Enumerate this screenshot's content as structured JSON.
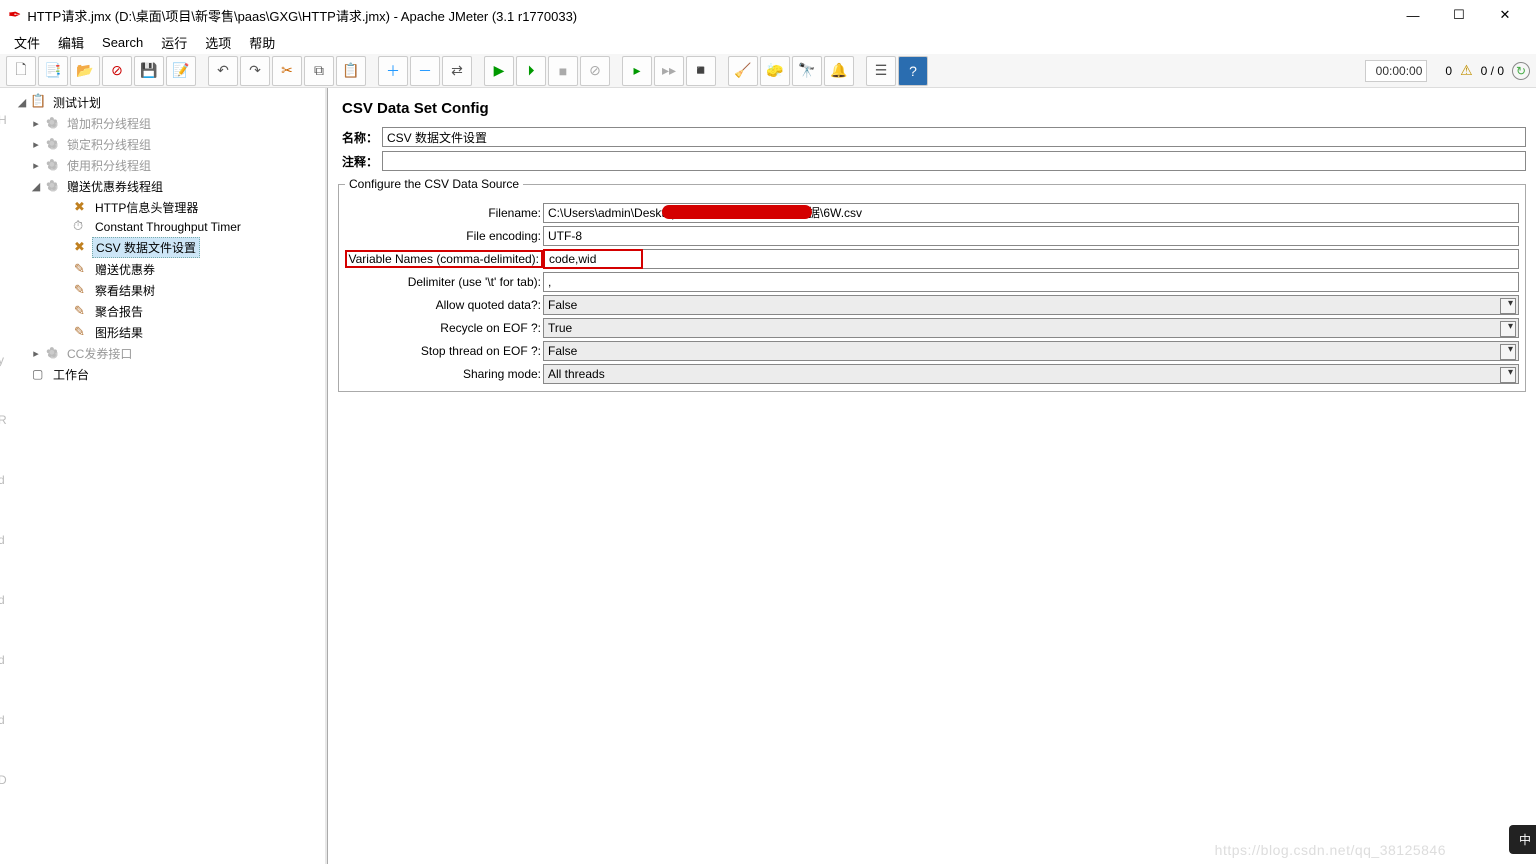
{
  "window": {
    "title": "HTTP请求.jmx (D:\\桌面\\项目\\新零售\\paas\\GXG\\HTTP请求.jmx) - Apache JMeter (3.1 r1770033)",
    "timer": "00:00:00",
    "warn_count": "0",
    "threads": "0 / 0"
  },
  "menu": {
    "file": "文件",
    "edit": "编辑",
    "search": "Search",
    "run": "运行",
    "options": "选项",
    "help": "帮助"
  },
  "tree": {
    "root": "测试计划",
    "g1": "增加积分线程组",
    "g2": "锁定积分线程组",
    "g3": "使用积分线程组",
    "g4": "赠送优惠券线程组",
    "g4c1": "HTTP信息头管理器",
    "g4c2": "Constant Throughput Timer",
    "g4c3": "CSV 数据文件设置",
    "g4c4": "赠送优惠券",
    "g4c5": "察看结果树",
    "g4c6": "聚合报告",
    "g4c7": "图形结果",
    "g5": "CC发券接口",
    "workbench": "工作台"
  },
  "panel": {
    "title": "CSV Data Set Config",
    "name_label": "名称：",
    "name_value": "CSV 数据文件设置",
    "comment_label": "注释：",
    "comment_value": "",
    "legend": "Configure the CSV Data Source",
    "filename_label": "Filename:",
    "filename_value": "C:\\Users\\admin\\Desktop\\                                     压测数据\\优惠券压测数据\\6W.csv",
    "encoding_label": "File encoding:",
    "encoding_value": "UTF-8",
    "vars_label": "Variable Names (comma-delimited):",
    "vars_value": "code,wid",
    "delim_label": "Delimiter (use '\\t' for tab):",
    "delim_value": ",",
    "quoted_label": "Allow quoted data?:",
    "quoted_value": "False",
    "recycle_label": "Recycle on EOF ?:",
    "recycle_value": "True",
    "stop_label": "Stop thread on EOF ?:",
    "stop_value": "False",
    "sharing_label": "Sharing mode:",
    "sharing_value": "All threads"
  },
  "watermark": "https://blog.csdn.net/qq_38125846"
}
